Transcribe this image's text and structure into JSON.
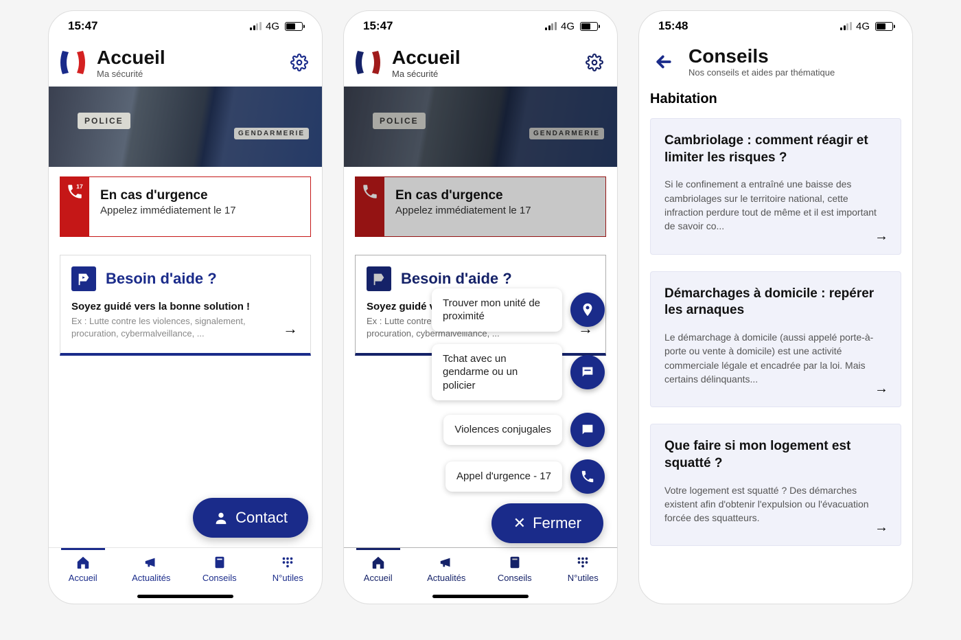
{
  "status": {
    "time1": "15:47",
    "time2": "15:47",
    "time3": "15:48",
    "network": "4G"
  },
  "screen1": {
    "header": {
      "title": "Accueil",
      "subtitle": "Ma sécurité"
    },
    "hero": {
      "police_label": "POLICE",
      "gend_label": "GENDARMERIE"
    },
    "emergency": {
      "badge_number": "17",
      "title": "En cas d'urgence",
      "subtitle": "Appelez immédiatement le 17"
    },
    "help": {
      "title": "Besoin d'aide ?",
      "lead": "Soyez guidé vers la bonne solution !",
      "example": "Ex : Lutte contre les violences, signalement, procuration, cybermalveillance, ..."
    },
    "contact_label": "Contact"
  },
  "screen2": {
    "fab_menu": [
      {
        "label": "Trouver mon unité de proximité",
        "icon": "pin"
      },
      {
        "label": "Tchat avec un gendarme ou un policier",
        "icon": "chat"
      },
      {
        "label": "Violences conjugales",
        "icon": "chat"
      },
      {
        "label": "Appel d'urgence - 17",
        "icon": "phone"
      }
    ],
    "close_label": "Fermer"
  },
  "screen3": {
    "header": {
      "title": "Conseils",
      "subtitle": "Nos conseils et aides par thématique"
    },
    "section": "Habitation",
    "cards": [
      {
        "title": "Cambriolage : comment réagir et limiter les risques ?",
        "desc": "Si le confinement a entraîné une baisse des cambriolages sur le territoire national, cette infraction perdure tout de même et il est important de savoir co..."
      },
      {
        "title": "Démarchages à domicile : repérer les arnaques",
        "desc": "Le démarchage à domicile (aussi appelé porte-à-porte ou vente à domicile) est une activité commerciale légale et encadrée par la loi. Mais certains délinquants..."
      },
      {
        "title": "Que faire si mon logement est squatté ?",
        "desc": "Votre logement est squatté ? Des démarches existent afin d'obtenir l'expulsion ou l'évacuation forcée des squatteurs."
      }
    ]
  },
  "nav": {
    "items": [
      {
        "label": "Accueil"
      },
      {
        "label": "Actualités"
      },
      {
        "label": "Conseils"
      },
      {
        "label": "N°utiles"
      }
    ]
  }
}
